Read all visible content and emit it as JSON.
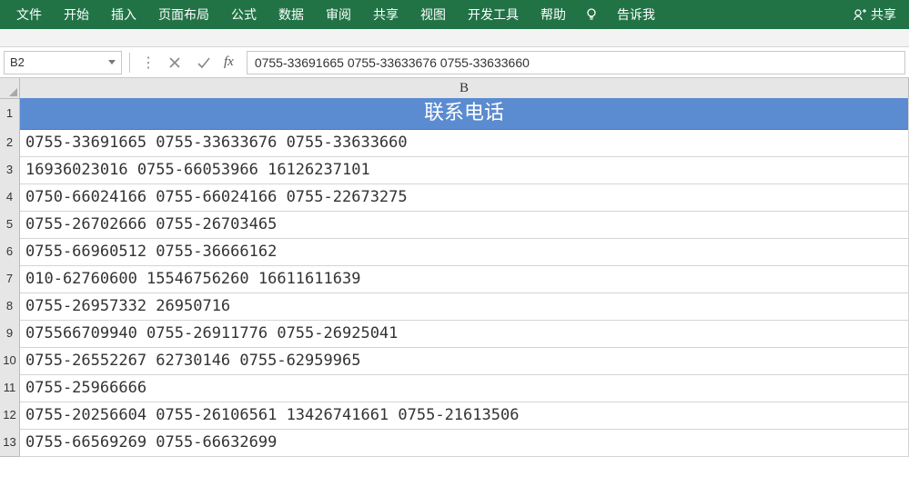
{
  "ribbon": {
    "tabs": [
      "文件",
      "开始",
      "插入",
      "页面布局",
      "公式",
      "数据",
      "审阅",
      "共享",
      "视图",
      "开发工具",
      "帮助"
    ],
    "tell_me": "告诉我",
    "share": "共享"
  },
  "formula_bar": {
    "name_box": "B2",
    "fx_label": "fx",
    "formula": "0755-33691665 0755-33633676 0755-33633660"
  },
  "sheet": {
    "column_letter": "B",
    "header_cell": "联系电话",
    "rows": [
      "0755-33691665 0755-33633676 0755-33633660",
      "16936023016 0755-66053966 16126237101",
      "0750-66024166 0755-66024166 0755-22673275",
      "0755-26702666 0755-26703465",
      "0755-66960512 0755-36666162",
      "010-62760600 15546756260 16611611639",
      "0755-26957332 26950716",
      "075566709940 0755-26911776 0755-26925041",
      "0755-26552267 62730146 0755-62959965",
      "0755-25966666",
      "0755-20256604 0755-26106561 13426741661 0755-21613506",
      "0755-66569269 0755-66632699"
    ],
    "row_numbers": [
      "1",
      "2",
      "3",
      "4",
      "5",
      "6",
      "7",
      "8",
      "9",
      "10",
      "11",
      "12",
      "13"
    ]
  }
}
